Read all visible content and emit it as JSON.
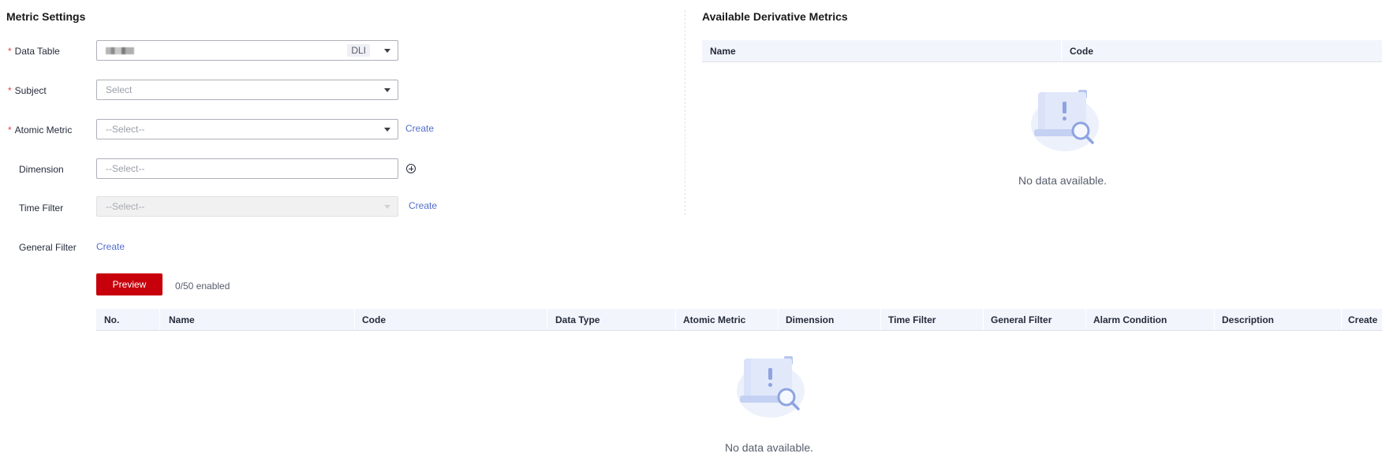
{
  "metric_settings": {
    "title": "Metric Settings",
    "fields": {
      "data_table": {
        "label": "Data Table",
        "required": true,
        "tag": "DLI"
      },
      "subject": {
        "label": "Subject",
        "required": true,
        "placeholder": "Select"
      },
      "atomic_metric": {
        "label": "Atomic Metric",
        "required": true,
        "placeholder": "--Select--",
        "action": "Create"
      },
      "dimension": {
        "label": "Dimension",
        "required": false,
        "placeholder": "--Select--"
      },
      "time_filter": {
        "label": "Time Filter",
        "required": false,
        "placeholder": "--Select--",
        "action": "Create",
        "disabled": true
      },
      "general_filter": {
        "label": "General Filter",
        "required": false,
        "action": "Create"
      }
    },
    "preview_button": "Preview",
    "enabled_count": "0/50 enabled",
    "required_mark": "*"
  },
  "derivative_metrics": {
    "title": "Available Derivative Metrics",
    "columns": [
      "Name",
      "Code"
    ],
    "empty_text": "No data available."
  },
  "preview_table": {
    "columns": [
      "No.",
      "Name",
      "Code",
      "Data Type",
      "Atomic Metric",
      "Dimension",
      "Time Filter",
      "General Filter",
      "Alarm Condition",
      "Description",
      "Create"
    ],
    "empty_text": "No data available."
  },
  "colors": {
    "primary": "#c7000b",
    "link": "#526ecc",
    "required": "#e54545",
    "table_header_bg": "#f2f5fc"
  },
  "icons": [
    "caret-down-icon",
    "add-circle-icon",
    "empty-document-search-icon"
  ]
}
